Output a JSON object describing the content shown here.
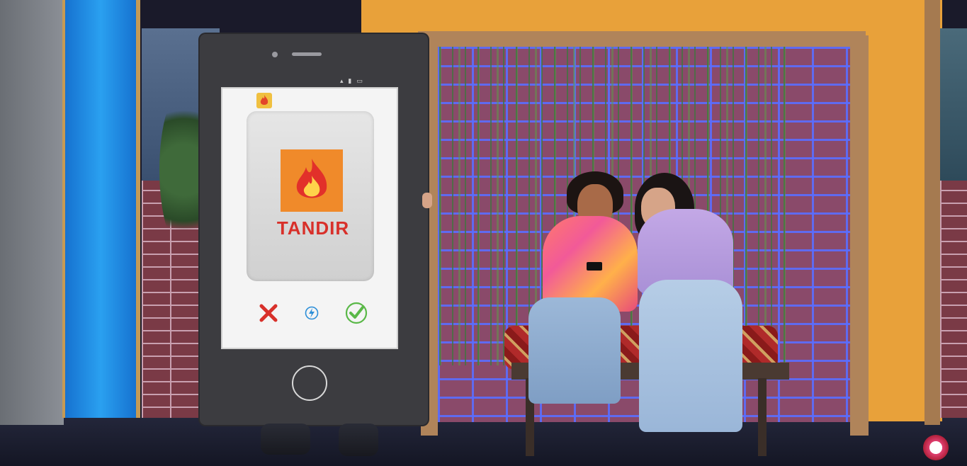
{
  "app_label": "TANDIR",
  "icons": {
    "app_icon": "flame-icon",
    "reject": "x-icon",
    "boost": "lightning-icon",
    "accept": "check-icon",
    "home": "home-button-icon"
  },
  "colors": {
    "orange_wall": "#e8a13a",
    "blue_panel": "#1e8ae6",
    "brand_red": "#d8302a",
    "app_orange": "#f08a2a",
    "accept_green": "#5ab848",
    "boost_blue": "#2d8fd8"
  }
}
